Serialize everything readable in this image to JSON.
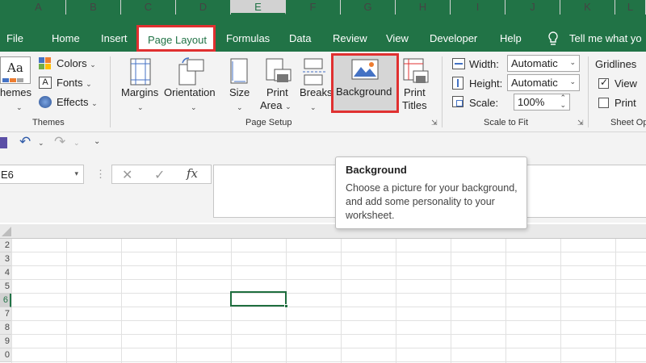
{
  "menu": {
    "tabs": [
      "File",
      "Home",
      "Insert",
      "Page Layout",
      "Formulas",
      "Data",
      "Review",
      "View",
      "Developer",
      "Help"
    ],
    "active_tab": "Page Layout",
    "tell_me": "Tell me what yo"
  },
  "ribbon": {
    "themes": {
      "themes_label": "hemes",
      "colors": "Colors",
      "fonts": "Fonts",
      "effects": "Effects",
      "group_label": "Themes"
    },
    "page_setup": {
      "margins": "Margins",
      "orientation": "Orientation",
      "size": "Size",
      "print_area_1": "Print",
      "print_area_2": "Area",
      "breaks": "Breaks",
      "background": "Background",
      "print_titles_1": "Print",
      "print_titles_2": "Titles",
      "group_label": "Page Setup"
    },
    "scale_to_fit": {
      "width_label": "Width:",
      "width_value": "Automatic",
      "height_label": "Height:",
      "height_value": "Automatic",
      "scale_label": "Scale:",
      "scale_value": "100%",
      "group_label": "Scale to Fit"
    },
    "sheet_options": {
      "gridlines": "Gridlines",
      "view": "View",
      "print": "Print",
      "group_label": "Sheet Op"
    }
  },
  "formula_bar": {
    "name_box": "E6",
    "fx": "fx"
  },
  "tooltip": {
    "title": "Background",
    "description": "Choose a picture for your background, and add some personality to your worksheet."
  },
  "grid": {
    "columns": [
      "A",
      "B",
      "C",
      "D",
      "E",
      "F",
      "G",
      "H",
      "I",
      "J",
      "K",
      "L"
    ],
    "rows": [
      "2",
      "3",
      "4",
      "5",
      "6",
      "7",
      "8",
      "9",
      "0"
    ],
    "selected_cell": "E6"
  },
  "colors": {
    "accent": "#217346",
    "highlight": "#e03030"
  }
}
